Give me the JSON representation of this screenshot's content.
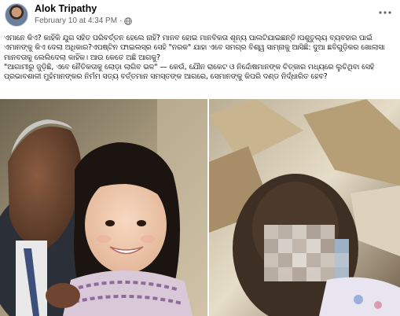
{
  "post": {
    "author": "Alok Tripathy",
    "timestamp": "February 10 at 4:34 PM",
    "separator": "·",
    "audience_icon": "globe-icon",
    "more_icon": "more-options-icon",
    "text_lines": [
      "ଏମାନେ କିଏ? କାହିଁକି ଯୁଗ ସହିତ ପରିବର୍ତ୍ତନ ହେଲେ ନାହିଁ? ମାନବ ହୋଇ ମାନବିକତା ଶୂନ୍ୟ ପାଲଟିଯାଇଛନ୍ତି।ପଶୁତୁଲ୍ୟ ବ୍ୟବହାର ପାଇଁ",
      "ଏମାନଙ୍କୁ କିଏ ଦେଲା ଅଧିକାର?ଏପଷ୍ଟିନ ଫାଇଲସ୍‌ର ସେହି \"ନରକ\" ଯାହା ଏବେ ସମଗ୍ର ବିଶ୍ୱ ସାମ୍ନାକୁ ଆସିଛି: ଦୁଆ ଛବିଗୁଡ଼ିକର ଖୋଲାସା",
      "ମାନବତାକୁ ଲେଲିଦେଲା କାହିଁକ। ଆଉ କେତେ ଅଛି ଆଗକୁ?",
      "\"ଆଗାମୀରୁ ଜୁଡ଼ିଛି, ଏବେ ନୈତିକତାକୁ ଲୋଡ଼ା ଲାଗିବ ଭଳ\" — କେଉଁ, ଯୌନ ରାକେଟ ଓ ନିର୍ଦ୍ଦୋଷମାନଙ୍କ ଚିତ୍କାର ମଧ୍ୟରେ ଲୁଚିଥିବା ସେହି",
      "ପ୍ରଭାବଶାଳୀ ମୁହଁମାନଙ୍କର ନିର୍ମମ ସତ୍ୟ ବର୍ତ୍ତମାନ ସମସ୍ତଙ୍କ ଆଗରେ, ସେମାନଙ୍କୁ କିପରି ଦଣ୍ଡ ନିର୍ଦ୍ଧାରିତ ହେବ?"
    ]
  },
  "media": {
    "left_photo": "man-with-smiling-girl-photo",
    "right_photo": "blurred-child-in-box-photo"
  },
  "colors": {
    "text": "#050505",
    "meta": "#65676b",
    "background": "#ffffff"
  }
}
